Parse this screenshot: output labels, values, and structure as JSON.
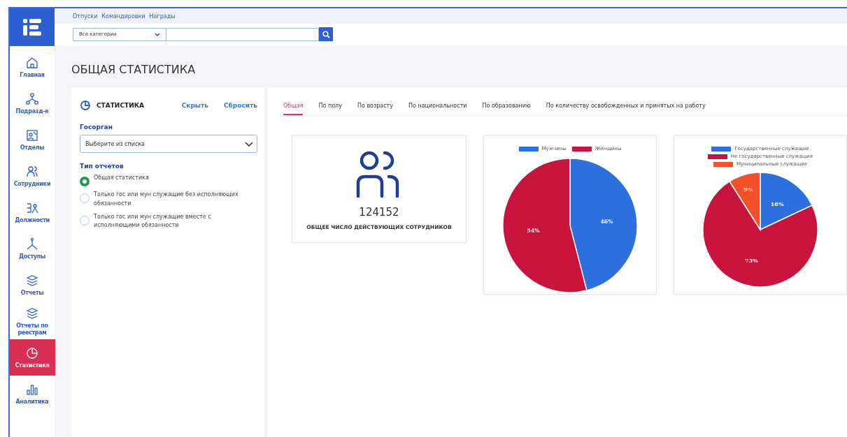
{
  "top_links": [
    "Отпуски",
    "Командировки",
    "Награды"
  ],
  "search": {
    "category": "Все категории"
  },
  "sidebar": {
    "items": [
      {
        "label": "Главная",
        "selected": false
      },
      {
        "label": "Подразд-е",
        "selected": false
      },
      {
        "label": "Отделы",
        "selected": false
      },
      {
        "label": "Сотрудники",
        "selected": false
      },
      {
        "label": "Должности",
        "selected": false
      },
      {
        "label": "Доступы",
        "selected": false
      },
      {
        "label": "Отчеты",
        "selected": false
      },
      {
        "label": "Отчеты по реестрам",
        "selected": false
      },
      {
        "label": "Статистика",
        "selected": true
      },
      {
        "label": "Аналитика",
        "selected": false
      }
    ]
  },
  "page_title": "ОБЩАЯ СТАТИСТИКА",
  "filter_panel": {
    "title": "СТАТИСТИКА",
    "hide_link": "Скрыть",
    "reset_link": "Сбросить",
    "agency_label": "Госорган",
    "agency_placeholder": "Выберите из списка",
    "report_type_label": "Тип отчетов",
    "options": [
      {
        "label": "Общая статистика",
        "selected": true
      },
      {
        "label": "Только гос или мун служащие без исполняющих обязанности",
        "selected": false
      },
      {
        "label": "Только гос или мун служащие вместе с исполняющими обязанности",
        "selected": false
      }
    ]
  },
  "tabs": [
    {
      "label": "Общая",
      "selected": true
    },
    {
      "label": "По полу",
      "selected": false
    },
    {
      "label": "По возрасту",
      "selected": false
    },
    {
      "label": "По национальности",
      "selected": false
    },
    {
      "label": "По образованию",
      "selected": false
    },
    {
      "label": "По количеству освобожденных и принятых на работу",
      "selected": false
    }
  ],
  "total_card": {
    "value": "124152",
    "caption": "ОБЩЕЕ ЧИСЛО ДЕЙСТВУЮЩИХ СОТРУДНИКОВ"
  },
  "charts": [
    {
      "chart_data": {
        "type": "pie",
        "categories": [
          "Мужчины",
          "Женщины"
        ],
        "values": [
          46,
          54
        ],
        "colors": [
          "#2d6fdc",
          "#c8143c"
        ],
        "legend": "top",
        "value_labels": [
          "46%",
          "54%"
        ]
      }
    },
    {
      "chart_data": {
        "type": "pie",
        "categories": [
          "Государственные служащие",
          "Не государственные служащие",
          "Муниципальные служащие"
        ],
        "values": [
          18,
          73,
          9
        ],
        "colors": [
          "#2d6fdc",
          "#c8143c",
          "#f4502a"
        ],
        "legend": "top",
        "value_labels": [
          "18%",
          "73%",
          "9%"
        ]
      }
    }
  ]
}
